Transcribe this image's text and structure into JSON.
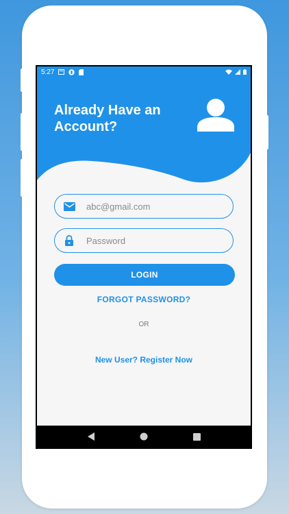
{
  "status_bar": {
    "time": "5:27",
    "left_icons": [
      "message-icon",
      "app-icon",
      "sim-icon"
    ],
    "right_icons": [
      "wifi-icon",
      "signal-icon",
      "battery-icon"
    ]
  },
  "login": {
    "title": "Already Have an Account?",
    "email_placeholder": "abc@gmail.com",
    "password_placeholder": "Password",
    "login_label": "LOGIN",
    "forgot_label": "FORGOT PASSWORD?",
    "or_label": "OR",
    "register_label": "New User? Register Now"
  },
  "nav": [
    "back-icon",
    "home-icon",
    "recents-icon"
  ],
  "colors": {
    "accent": "#1f91e8",
    "background": "#f6f6f6",
    "page_gradient_top": "#3f97de",
    "page_gradient_bottom": "#c9d8e3"
  }
}
